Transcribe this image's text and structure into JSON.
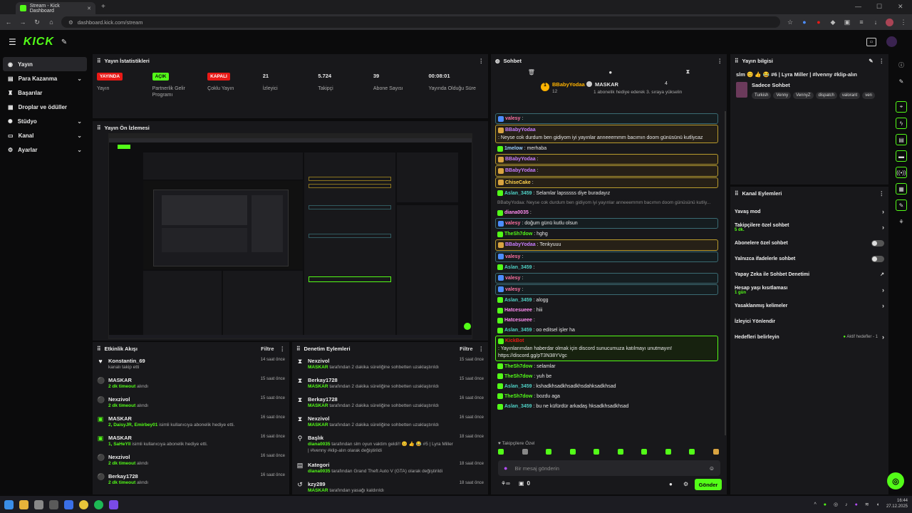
{
  "browser": {
    "tab_title": "Stream - Kick Dashboard",
    "url": "dashboard.kick.com/stream"
  },
  "app": {
    "logo": "KICK"
  },
  "sidebar": {
    "items": [
      {
        "label": "Yayın",
        "icon": "broadcast-icon",
        "active": true
      },
      {
        "label": "Para Kazanma",
        "icon": "money-icon",
        "chevron": true
      },
      {
        "label": "Başarılar",
        "icon": "trophy-icon"
      },
      {
        "label": "Droplar ve ödüller",
        "icon": "gift-icon"
      },
      {
        "label": "Stüdyo",
        "icon": "studio-icon",
        "chevron": true
      },
      {
        "label": "Kanal",
        "icon": "channel-icon",
        "chevron": true
      },
      {
        "label": "Ayarlar",
        "icon": "gear-icon",
        "chevron": true
      }
    ]
  },
  "stats": {
    "title": "Yayın İstatistikleri",
    "items": [
      {
        "value": "YAYINDA",
        "label": "Yayın",
        "badge": "red"
      },
      {
        "value": "AÇIK",
        "label": "Partnerlik Gelir Programı",
        "badge": "green"
      },
      {
        "value": "KAPALI",
        "label": "Çoklu Yayın",
        "badge": "red"
      },
      {
        "value": "21",
        "label": "İzleyici"
      },
      {
        "value": "5.724",
        "label": "Takipçi"
      },
      {
        "value": "39",
        "label": "Abone Sayısı"
      },
      {
        "value": "00:08:01",
        "label": "Yayında Olduğu Süre"
      }
    ]
  },
  "preview": {
    "title": "Yayın Ön İzlemesi"
  },
  "activity": {
    "title": "Etkinlik Akışı",
    "filter": "Filtre",
    "items": [
      {
        "icon": "heart-icon",
        "name": "Konstantin_69",
        "action": "kanalı takip etti",
        "time": "14 saat önce"
      },
      {
        "icon": "timeout-icon",
        "name": "MASKAR",
        "highlight": "2 dk timeout",
        "action": "alındı",
        "time": "15 saat önce"
      },
      {
        "icon": "timeout-icon",
        "name": "Nexzivol",
        "highlight": "2 dk timeout",
        "action": "alındı",
        "time": "15 saat önce"
      },
      {
        "icon": "gift-icon",
        "name": "MASKAR",
        "highlight": "2, DaisyJR, Emirbey01",
        "action": "isimli kullanıcıya abonelik hediye etti.",
        "time": "16 saat önce"
      },
      {
        "icon": "gift-icon",
        "name": "MASKAR",
        "highlight": "1, SaHeYll",
        "action": "isimli kullanıcıya abonelik hediye etti.",
        "time": "16 saat önce"
      },
      {
        "icon": "timeout-icon",
        "name": "Nexzivol",
        "highlight": "2 dk timeout",
        "action": "alındı",
        "time": "16 saat önce"
      },
      {
        "icon": "timeout-icon",
        "name": "Berkay1728",
        "highlight": "2 dk timeout",
        "action": "alındı",
        "time": "16 saat önce"
      }
    ]
  },
  "moderation": {
    "title": "Denetim Eylemleri",
    "filter": "Filtre",
    "items": [
      {
        "icon": "hourglass-icon",
        "name": "Nexzivol",
        "highlight": "MASKAR",
        "action": "tarafından 2 dakika süreliğine sohbetten uzaklaştırıldı",
        "time": "15 saat önce"
      },
      {
        "icon": "hourglass-icon",
        "name": "Berkay1728",
        "highlight": "MASKAR",
        "action": "tarafından 2 dakika süreliğine sohbetten uzaklaştırıldı",
        "time": "15 saat önce"
      },
      {
        "icon": "hourglass-icon",
        "name": "Berkay1728",
        "highlight": "MASKAR",
        "action": "tarafından 2 dakika süreliğine sohbetten uzaklaştırıldı",
        "time": "16 saat önce"
      },
      {
        "icon": "hourglass-icon",
        "name": "Nexzivol",
        "highlight": "MASKAR",
        "action": "tarafından 2 dakika süreliğine sohbetten uzaklaştırıldı",
        "time": "16 saat önce"
      },
      {
        "icon": "title-icon",
        "name": "Başlık",
        "highlight": "diana0035",
        "action": "tarafından slm oyun vaktim geldi!! 😊 👍 😂 #5 | Lyra Miller | #lvenny #klip-alın olarak değiştirildi",
        "time": "18 saat önce"
      },
      {
        "icon": "category-icon",
        "name": "Kategori",
        "highlight": "diana0035",
        "action": "tarafından Grand Theft Auto V (GTA) olarak değiştirildi",
        "time": "18 saat önce"
      },
      {
        "icon": "undo-icon",
        "name": "kzy289",
        "highlight": "MASKAR",
        "action": "tarafından yasağı kaldırıldı",
        "time": "18 saat önce"
      }
    ]
  },
  "chat": {
    "title": "Sohbet",
    "pinned": {
      "user1": "BBabyYodaa",
      "count1": "12",
      "user2": "MASKAR",
      "count2": "4",
      "text": "1 abonelik hediye ederek 3. sıraya yükselin"
    },
    "messages": [
      {
        "style": "blue",
        "user": "valesy",
        "ucolor": "#ff6fa0",
        "text": ":"
      },
      {
        "style": "hl",
        "user": "BBabyYodaa",
        "ucolor": "#c77dff",
        "text": ": Neyse cok durdum ben gidiyom iyi yayınlar anneeemmm bacımın doom günüsünü kutliycaz"
      },
      {
        "style": "",
        "user": "1melow",
        "ucolor": "#9ad1ff",
        "text": ": merhaba"
      },
      {
        "style": "hl",
        "user": "BBabyYodaa",
        "ucolor": "#c77dff",
        "text": ":"
      },
      {
        "style": "hl",
        "user": "BBabyYodaa",
        "ucolor": "#c77dff",
        "text": ":"
      },
      {
        "style": "hl",
        "user": "ChiseCake",
        "ucolor": "#ffd24d",
        "text": ":"
      },
      {
        "style": "",
        "user": "Aslan_3459",
        "ucolor": "#4fd1c5",
        "text": ": Selamlar lapsssss diye buradayız"
      },
      {
        "style": "sys",
        "user": "",
        "ucolor": "#888",
        "text": "BBabyYodaa: Neyse cok durdum ben gidiyom iyi yayınlar anneeemmm bacımın doom günüsünü kutliy..."
      },
      {
        "style": "",
        "user": "diana0035",
        "ucolor": "#ff8cf0",
        "text": ":"
      },
      {
        "style": "blue",
        "user": "valesy",
        "ucolor": "#ff6fa0",
        "text": ": doğum günü kutlu olsun"
      },
      {
        "style": "",
        "user": "TheSh7dow",
        "ucolor": "#53fc18",
        "text": ": hghg"
      },
      {
        "style": "hl",
        "user": "BBabyYodaa",
        "ucolor": "#c77dff",
        "text": ": Tenkyuuu"
      },
      {
        "style": "blue",
        "user": "valesy",
        "ucolor": "#ff6fa0",
        "text": ":"
      },
      {
        "style": "",
        "user": "Aslan_3459",
        "ucolor": "#4fd1c5",
        "text": ":"
      },
      {
        "style": "blue",
        "user": "valesy",
        "ucolor": "#ff6fa0",
        "text": ":"
      },
      {
        "style": "blue",
        "user": "valesy",
        "ucolor": "#ff6fa0",
        "text": ":"
      },
      {
        "style": "",
        "user": "Aslan_3459",
        "ucolor": "#4fd1c5",
        "text": ": alogg"
      },
      {
        "style": "",
        "user": "Hatcesueee",
        "ucolor": "#ff8cf0",
        "text": ": hiii"
      },
      {
        "style": "",
        "user": "Hatcesueee",
        "ucolor": "#ff8cf0",
        "text": ":"
      },
      {
        "style": "",
        "user": "Aslan_3459",
        "ucolor": "#4fd1c5",
        "text": ": oo editsel işler ha"
      },
      {
        "style": "green",
        "user": "KickBot",
        "ucolor": "#e91916",
        "text": ": Yayınlarımdan haberdar olmak için discord sunucumuza katılmayı unutmayın! https://discord.gg/pT3N38YVgc"
      },
      {
        "style": "",
        "user": "TheSh7dow",
        "ucolor": "#53fc18",
        "text": ": selamlar"
      },
      {
        "style": "",
        "user": "TheSh7dow",
        "ucolor": "#53fc18",
        "text": ": yuh be"
      },
      {
        "style": "",
        "user": "Aslan_3459",
        "ucolor": "#4fd1c5",
        "text": ": kshadkhsadkhsadkhsdahksadkhsad"
      },
      {
        "style": "",
        "user": "TheSh7dow",
        "ucolor": "#53fc18",
        "text": ": bozdu aga"
      },
      {
        "style": "",
        "user": "Aslan_3459",
        "ucolor": "#4fd1c5",
        "text": ": bu ne küfürdür arkadaş hksadkhsadkhsad"
      }
    ],
    "followers_only": "Takipçilere Özel",
    "input_placeholder": "Bir mesaj gönderin",
    "count": "0",
    "send": "Gönder"
  },
  "stream_info": {
    "title": "Yayın bilgisi",
    "stream_title": "slm 😊 👍 😂 #6 | Lyra Miller | #lvenny #klip-alın",
    "category": "Sadece Sohbet",
    "tags": [
      "Turkish",
      "Venny",
      "VennyZ",
      "dispatch",
      "valorant",
      "ven"
    ]
  },
  "channel_actions": {
    "title": "Kanal Eylemleri",
    "items": [
      {
        "label": "Yavaş mod",
        "type": "chevron"
      },
      {
        "label": "Takipçilere özel sohbet",
        "sub": "5 dk.",
        "type": "chevron"
      },
      {
        "label": "Abonelere özel sohbet",
        "type": "toggle"
      },
      {
        "label": "Yalnızca ifadelerle sohbet",
        "type": "toggle"
      },
      {
        "label": "Yapay Zeka ile Sohbet Denetimi",
        "type": "external"
      },
      {
        "label": "Hesap yaşı kısıtlaması",
        "sub": "1 gün",
        "type": "chevron"
      },
      {
        "label": "Yasaklanmış kelimeler",
        "type": "chevron"
      },
      {
        "label": "İzleyici Yönlendir",
        "type": "none"
      },
      {
        "label": "Hedefleri belirleyin",
        "status": "Aktif hedefler - 1",
        "type": "chevron"
      }
    ]
  },
  "taskbar": {
    "time": "16:44",
    "date": "27.12.2025"
  }
}
